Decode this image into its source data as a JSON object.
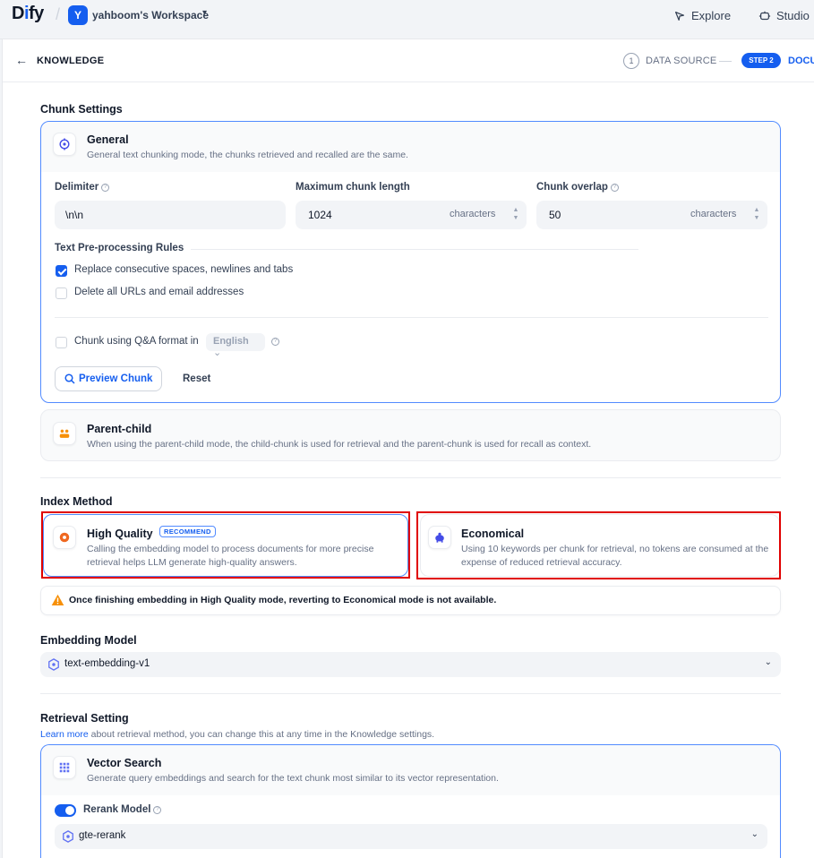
{
  "nav": {
    "logo_prefix": "D",
    "logo_i": "i",
    "logo_suffix": "fy",
    "workspace_initial": "Y",
    "workspace_name": "yahboom's Workspace",
    "explore": "Explore",
    "studio": "Studio"
  },
  "header": {
    "back_label": "KNOWLEDGE",
    "step1_number": "1",
    "step1_label": "DATA SOURCE",
    "step2_badge": "STEP 2",
    "step2_label": "DOCU"
  },
  "chunk_settings": {
    "title": "Chunk Settings",
    "general": {
      "title": "General",
      "desc": "General text chunking mode, the chunks retrieved and recalled are the same.",
      "delimiter_label": "Delimiter",
      "delimiter_value": "\\n\\n",
      "max_length_label": "Maximum chunk length",
      "max_length_value": "1024",
      "overlap_label": "Chunk overlap",
      "overlap_value": "50",
      "unit": "characters",
      "rules_heading": "Text Pre-processing Rules",
      "rule_spaces": "Replace consecutive spaces, newlines and tabs",
      "rule_spaces_checked": true,
      "rule_urls": "Delete all URLs and email addresses",
      "rule_urls_checked": false,
      "qa_label": "Chunk using Q&A format in",
      "qa_checked": false,
      "qa_language": "English",
      "preview_button": "Preview Chunk",
      "reset_button": "Reset"
    },
    "parent_child": {
      "title": "Parent-child",
      "desc": "When using the parent-child mode, the child-chunk is used for retrieval and the parent-chunk is used for recall as context."
    }
  },
  "index_method": {
    "title": "Index Method",
    "high_quality": {
      "title": "High Quality",
      "badge": "RECOMMEND",
      "desc": "Calling the embedding model to process documents for more precise retrieval helps LLM generate high-quality answers."
    },
    "economical": {
      "title": "Economical",
      "desc": "Using 10 keywords per chunk for retrieval, no tokens are consumed at the expense of reduced retrieval accuracy."
    },
    "warning": "Once finishing embedding in High Quality mode, reverting to Economical mode is not available."
  },
  "embedding": {
    "title": "Embedding Model",
    "model": "text-embedding-v1"
  },
  "retrieval": {
    "title": "Retrieval Setting",
    "learn_more": "Learn more",
    "learn_rest": " about retrieval method, you can change this at any time in the Knowledge settings.",
    "vector": {
      "title": "Vector Search",
      "desc": "Generate query embeddings and search for the text chunk most similar to its vector representation."
    },
    "rerank_label": "Rerank Model",
    "rerank_enabled": true,
    "rerank_model": "gte-rerank"
  },
  "colors": {
    "accent": "#155eef",
    "highlight": "#e00000",
    "warning": "#f79009"
  }
}
